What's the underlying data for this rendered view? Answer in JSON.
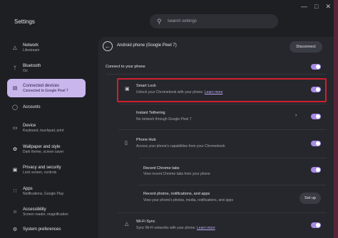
{
  "window": {
    "title": "Settings"
  },
  "search": {
    "placeholder": "Search settings"
  },
  "sidebar": {
    "items": [
      {
        "title": "Network",
        "subtitle": "Lifestream",
        "icon": "wifi-icon"
      },
      {
        "title": "Bluetooth",
        "subtitle": "On",
        "icon": "bluetooth-icon"
      },
      {
        "title": "Connected devices",
        "subtitle": "Connected to Google Pixel 7",
        "icon": "devices-icon",
        "active": true
      },
      {
        "title": "Accounts",
        "subtitle": "",
        "icon": "account-icon"
      },
      {
        "title": "Device",
        "subtitle": "Keyboard, touchpad, print",
        "icon": "laptop-icon"
      },
      {
        "title": "Wallpaper and style",
        "subtitle": "Dark theme, screen saver",
        "icon": "palette-icon"
      },
      {
        "title": "Privacy and security",
        "subtitle": "Lock screen, controls",
        "icon": "lock-icon"
      },
      {
        "title": "Apps",
        "subtitle": "Notifications, Google Play",
        "icon": "apps-icon"
      },
      {
        "title": "Accessibility",
        "subtitle": "Screen reader, magnification",
        "icon": "accessibility-icon"
      },
      {
        "title": "System preferences",
        "subtitle": "",
        "icon": "system-icon"
      }
    ]
  },
  "panel": {
    "title": "Android phone (Google Pixel 7)",
    "disconnect_label": "Disconnect",
    "connect_label": "Connect to your phone",
    "smart_lock": {
      "title": "Smart Lock",
      "subtitle": "Unlock your Chromebook with your phone.",
      "link": "Learn more"
    },
    "instant_tethering": {
      "title": "Instant Tethering",
      "subtitle": "No network through Google Pixel 7"
    },
    "phone_hub": {
      "title": "Phone Hub",
      "subtitle": "Access your phone's capabilities from your Chromebook"
    },
    "chrome_tabs": {
      "title": "Recent Chrome tabs",
      "subtitle": "View recent Chrome tabs from your phone"
    },
    "recent_photos": {
      "title": "Recent photos, notifications, and apps",
      "subtitle": "View your phone's photos, media, notifications, and apps",
      "button": "Set up"
    },
    "wifi_sync": {
      "title": "Wi-Fi Sync",
      "subtitle": "Sync Wi-Fi networks with your phone.",
      "link": "Learn more"
    }
  },
  "colors": {
    "accent": "#a88be6",
    "active_nav": "#c8b6ec",
    "highlight": "#d01f2f",
    "background": "#1e1f23"
  }
}
